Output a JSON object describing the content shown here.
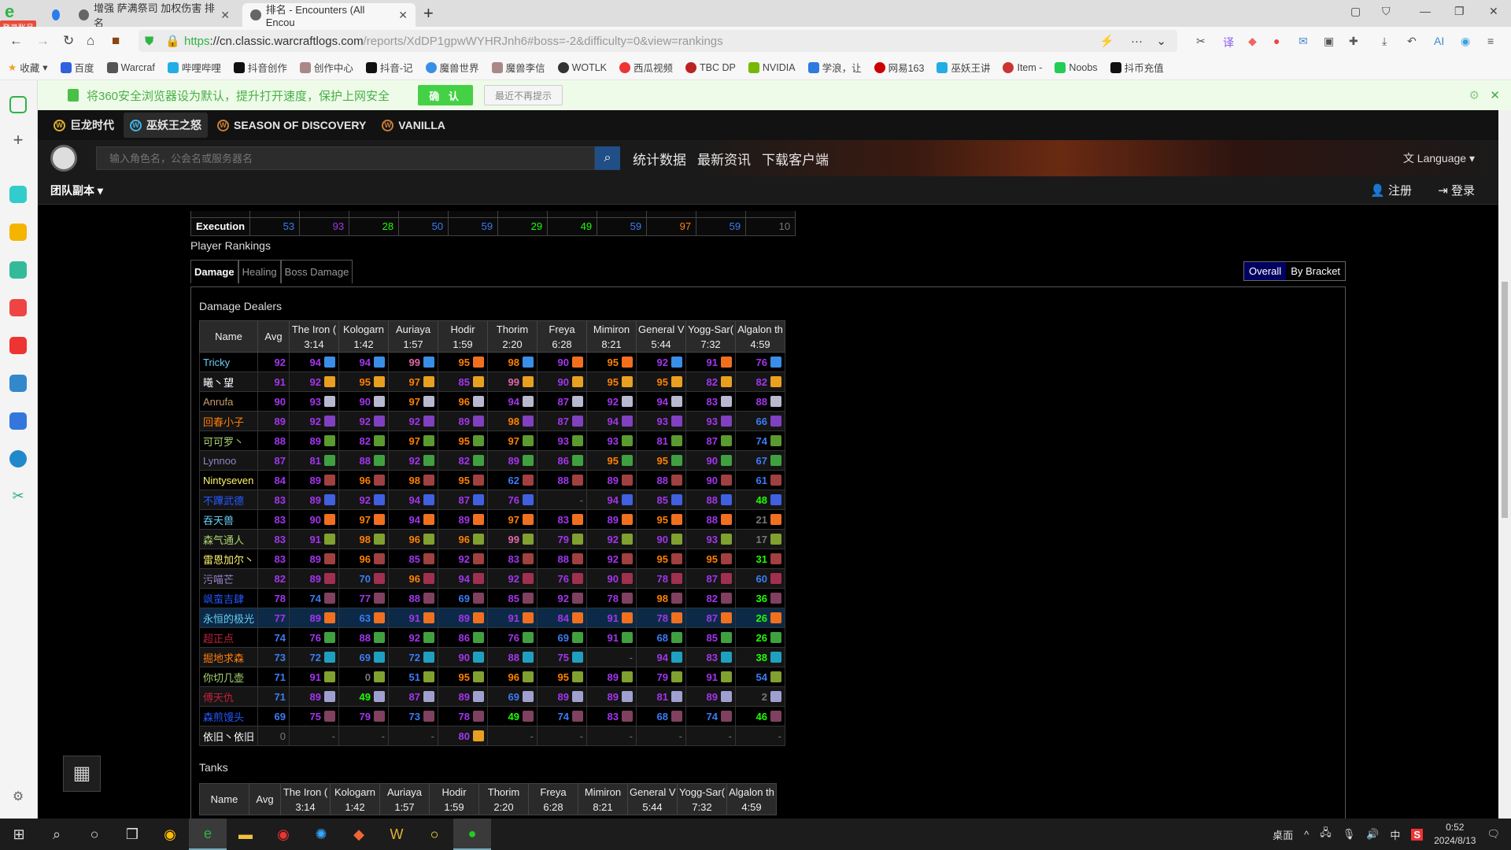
{
  "browser": {
    "login_badge": "登录账号",
    "tabs": [
      {
        "label": "增强 萨满祭司 加权伤害 排名",
        "active": false
      },
      {
        "label": "排名 - Encounters (All Encou",
        "active": true
      }
    ],
    "url_https": "https",
    "url_host": "://cn.classic.warcraftlogs.com",
    "url_path": "/reports/XdDP1gpwWYHRJnh6#boss=-2&difficulty=0&view=rankings",
    "bookmarks": [
      "收藏",
      "百度",
      "Warcraf",
      "哔哩哔哩",
      "抖音创作",
      "创作中心",
      "抖音-记",
      "魔兽世界",
      "魔兽李信",
      "WOTLK",
      "西瓜视频",
      "TBC DP",
      "NVIDIA",
      "学浪，让",
      "网易163",
      "巫妖王讲",
      "Item -",
      "Noobs",
      "抖币充值"
    ],
    "notification": {
      "text": "将360安全浏览器设为默认，提升打开速度，保护上网安全",
      "confirm": "确 认",
      "dismiss": "最近不再提示"
    }
  },
  "site": {
    "games": [
      "巨龙时代",
      "巫妖王之怒",
      "SEASON OF DISCOVERY",
      "VANILLA"
    ],
    "active_game": "巫妖王之怒",
    "search_placeholder": "输入角色名，公会名或服务器名",
    "nav": [
      "统计数据",
      "最新资讯",
      "下载客户端"
    ],
    "language": "Language",
    "raid_menu": "团队副本",
    "register": "注册",
    "login": "登录"
  },
  "execution": {
    "label": "Execution",
    "values": [
      {
        "v": "53",
        "c": "#3b7cf5"
      },
      {
        "v": "93",
        "c": "#a335ee"
      },
      {
        "v": "28",
        "c": "#1eff00"
      },
      {
        "v": "50",
        "c": "#3b7cf5"
      },
      {
        "v": "59",
        "c": "#3b7cf5"
      },
      {
        "v": "29",
        "c": "#1eff00"
      },
      {
        "v": "49",
        "c": "#1eff00"
      },
      {
        "v": "59",
        "c": "#3b7cf5"
      },
      {
        "v": "97",
        "c": "#ff8000"
      },
      {
        "v": "59",
        "c": "#3b7cf5"
      },
      {
        "v": "10",
        "c": "#777777"
      }
    ]
  },
  "rankings": {
    "title": "Player Rankings",
    "tabs": [
      "Damage",
      "Healing",
      "Boss Damage"
    ],
    "active_tab": "Damage",
    "bracket": [
      "Overall",
      "By Bracket"
    ],
    "active_bracket": "Overall",
    "columns": [
      {
        "name": "The Iron Council",
        "short": "The Iron (",
        "time": "3:14"
      },
      {
        "name": "Kologarn",
        "short": "Kologarn",
        "time": "1:42"
      },
      {
        "name": "Auriaya",
        "short": "Auriaya",
        "time": "1:57"
      },
      {
        "name": "Hodir",
        "short": "Hodir",
        "time": "1:59"
      },
      {
        "name": "Thorim",
        "short": "Thorim",
        "time": "2:20"
      },
      {
        "name": "Freya",
        "short": "Freya",
        "time": "6:28"
      },
      {
        "name": "Mimiron",
        "short": "Mimiron",
        "time": "8:21"
      },
      {
        "name": "General Vezax",
        "short": "General V",
        "time": "5:44"
      },
      {
        "name": "Yogg-Saron",
        "short": "Yogg-Sar(",
        "time": "7:32"
      },
      {
        "name": "Algalon the Observer",
        "short": "Algalon th",
        "time": "4:59"
      }
    ],
    "header_name": "Name",
    "header_avg": "Avg",
    "dps_title": "Damage Dealers",
    "tanks_title": "Tanks",
    "spec_icons": {
      "frost": "#3a8ee6",
      "unholy": "#e8a020",
      "balance": "#b8b8d0",
      "shadow": "#8040c0",
      "beast": "#5a9a30",
      "feral": "#40a040",
      "fury": "#a04040",
      "ele": "#4060e0",
      "fire": "#f07020",
      "surv": "#80a030",
      "arms": "#a04040",
      "demo": "#a03050",
      "aff": "#804060",
      "disease": "#40a040",
      "enh": "#20a0c0",
      "shadowp": "#a0a0d0"
    },
    "dps": [
      {
        "name": "Tricky",
        "color": "#69ccf0",
        "avg": "92",
        "icon": "frost",
        "scores": [
          "94",
          "94",
          "99",
          "95",
          "98",
          "90",
          "95",
          "92",
          "91",
          "76"
        ],
        "iconset": [
          "frost",
          "frost",
          "frost",
          "fire",
          "frost",
          "fire",
          "fire",
          "frost",
          "fire",
          "frost"
        ]
      },
      {
        "name": "曦丶望",
        "color": "#ffffff",
        "avg": "91",
        "icon": "unholy",
        "scores": [
          "92",
          "95",
          "97",
          "85",
          "99",
          "90",
          "95",
          "95",
          "82",
          "82"
        ]
      },
      {
        "name": "Anrufa",
        "color": "#c79c6e",
        "avg": "90",
        "icon": "balance",
        "scores": [
          "93",
          "90",
          "97",
          "96",
          "94",
          "87",
          "92",
          "94",
          "83",
          "88"
        ]
      },
      {
        "name": "回春小子",
        "color": "#ff7d0a",
        "avg": "89",
        "icon": "shadow",
        "scores": [
          "92",
          "92",
          "92",
          "89",
          "98",
          "87",
          "94",
          "93",
          "93",
          "66"
        ]
      },
      {
        "name": "可可罗丶",
        "color": "#abd473",
        "avg": "88",
        "icon": "beast",
        "scores": [
          "89",
          "82",
          "97",
          "95",
          "97",
          "93",
          "93",
          "81",
          "87",
          "74"
        ]
      },
      {
        "name": "Lynnoo",
        "color": "#9482c9",
        "avg": "87",
        "icon": "feral",
        "scores": [
          "81",
          "88",
          "92",
          "82",
          "89",
          "86",
          "95",
          "95",
          "90",
          "67"
        ]
      },
      {
        "name": "Nintyseven",
        "color": "#fff569",
        "avg": "84",
        "icon": "fury",
        "scores": [
          "89",
          "96",
          "98",
          "95",
          "62",
          "88",
          "89",
          "88",
          "90",
          "61"
        ]
      },
      {
        "name": "不蹕武德",
        "color": "#2459ff",
        "avg": "83",
        "icon": "ele",
        "scores": [
          "89",
          "92",
          "94",
          "87",
          "76",
          "-",
          "94",
          "85",
          "88",
          "48"
        ]
      },
      {
        "name": "吞天兽",
        "color": "#69ccf0",
        "avg": "83",
        "icon": "fire",
        "scores": [
          "90",
          "97",
          "94",
          "89",
          "97",
          "83",
          "89",
          "95",
          "88",
          "21"
        ]
      },
      {
        "name": "森气通人",
        "color": "#abd473",
        "avg": "83",
        "icon": "surv",
        "scores": [
          "91",
          "98",
          "96",
          "96",
          "99",
          "79",
          "92",
          "90",
          "93",
          "17"
        ]
      },
      {
        "name": "雷恩加尔丶",
        "color": "#fff569",
        "avg": "83",
        "icon": "arms",
        "scores": [
          "89",
          "96",
          "85",
          "92",
          "83",
          "88",
          "92",
          "95",
          "95",
          "31"
        ]
      },
      {
        "name": "污喵芒",
        "color": "#9482c9",
        "avg": "82",
        "icon": "demo",
        "scores": [
          "89",
          "70",
          "96",
          "94",
          "92",
          "76",
          "90",
          "78",
          "87",
          "60"
        ]
      },
      {
        "name": "飒蛮吉肆",
        "color": "#2459ff",
        "avg": "78",
        "icon": "aff",
        "scores": [
          "74",
          "77",
          "88",
          "69",
          "85",
          "92",
          "78",
          "98",
          "82",
          "36"
        ]
      },
      {
        "name": "永恒的极光",
        "color": "#69ccf0",
        "avg": "77",
        "icon": "fire",
        "highlight": true,
        "scores": [
          "89",
          "63",
          "91",
          "89",
          "91",
          "84",
          "91",
          "78",
          "87",
          "26"
        ]
      },
      {
        "name": "超正点",
        "color": "#c41f3b",
        "avg": "74",
        "icon": "disease",
        "scores": [
          "76",
          "88",
          "92",
          "86",
          "76",
          "69",
          "91",
          "68",
          "85",
          "26"
        ]
      },
      {
        "name": "掘地求森",
        "color": "#ff7d0a",
        "avg": "73",
        "icon": "enh",
        "scores": [
          "72",
          "69",
          "72",
          "90",
          "88",
          "75",
          "-",
          "94",
          "83",
          "38"
        ]
      },
      {
        "name": "你切几壶",
        "color": "#abd473",
        "avg": "71",
        "icon": "surv",
        "scores": [
          "91",
          "0",
          "51",
          "95",
          "96",
          "95",
          "89",
          "79",
          "91",
          "54"
        ]
      },
      {
        "name": "傅天仇",
        "color": "#c41f3b",
        "avg": "71",
        "icon": "shadowp",
        "scores": [
          "89",
          "49",
          "87",
          "89",
          "69",
          "89",
          "89",
          "81",
          "89",
          "2"
        ]
      },
      {
        "name": "森煎馒头",
        "color": "#2459ff",
        "avg": "69",
        "icon": "aff",
        "scores": [
          "75",
          "79",
          "73",
          "78",
          "49",
          "74",
          "83",
          "68",
          "74",
          "46"
        ]
      },
      {
        "name": "依旧丶依旧",
        "color": "#ffffff",
        "avg": "0",
        "icon": "unholy",
        "scores": [
          "-",
          "-",
          "-",
          "80",
          "-",
          "-",
          "-",
          "-",
          "-",
          "-"
        ]
      }
    ]
  },
  "taskbar": {
    "desktop": "桌面",
    "ime": "中",
    "time": "0:52",
    "date": "2024/8/13"
  }
}
